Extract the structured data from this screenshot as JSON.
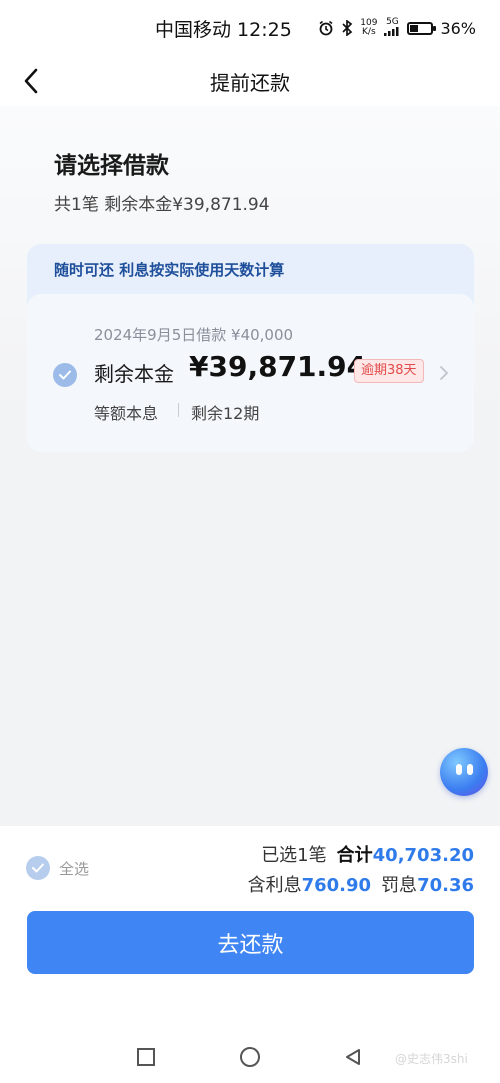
{
  "status_bar": {
    "carrier_time": "中国移动 12:25",
    "net_speed_top": "109",
    "net_speed_bottom": "K/s",
    "signal_label": "5G",
    "battery": "36%",
    "battery_level_percent": 36
  },
  "header": {
    "title": "提前还款",
    "back_icon": "chevron-left-icon"
  },
  "section": {
    "title": "请选择借款",
    "subtitle": "共1笔 剩余本金¥39,871.94"
  },
  "loan_panel": {
    "hint": "随时可还 利息按实际使用天数计算",
    "loan": {
      "date_amount": "2024年9月5日借款 ¥40,000",
      "remain_label": "剩余本金",
      "remain_value": "¥39,871.94",
      "overdue": "逾期38天",
      "repay_type": "等额本息",
      "remain_periods": "剩余12期",
      "selected": true
    }
  },
  "bottom": {
    "select_all": "全选",
    "selected_count": "已选1笔",
    "total_label": "合计",
    "total_value": "40,703.20",
    "interest_label": "含利息",
    "interest_value": "760.90",
    "penalty_label": "罚息",
    "penalty_value": "70.36",
    "repay_button": "去还款"
  },
  "watermark": "@史志伟3shi",
  "colors": {
    "accent": "#3f85f3",
    "amount_blue": "#2f7bea",
    "overdue_red": "#e34a4a",
    "panel_bg": "#e6effb"
  }
}
